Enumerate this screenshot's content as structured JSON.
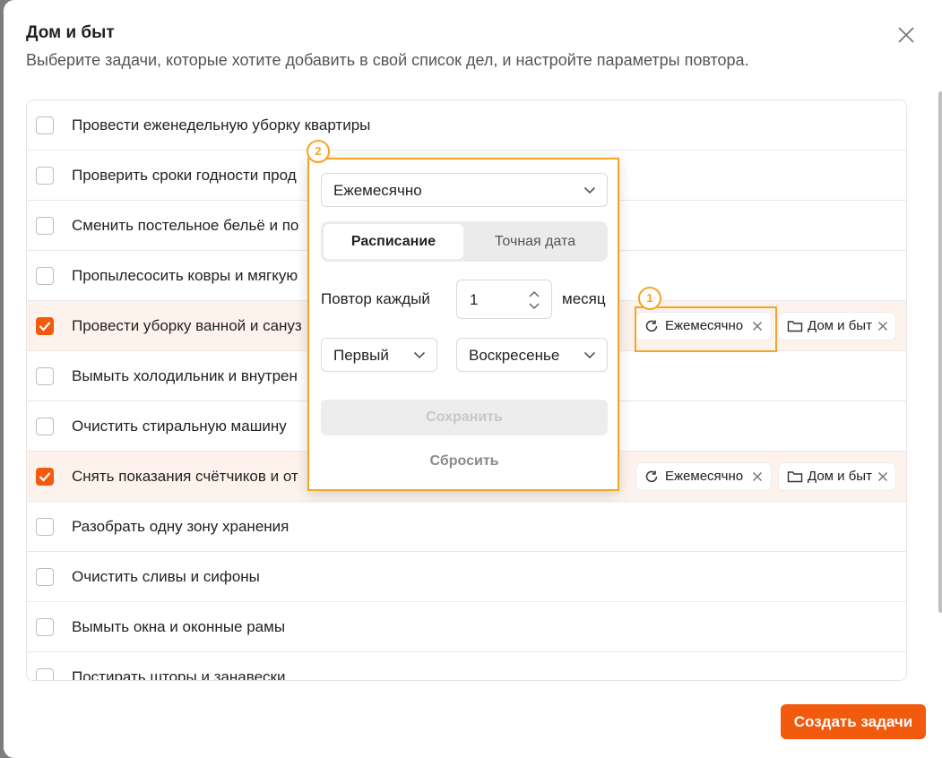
{
  "dialog": {
    "title": "Дом и быт",
    "subtitle": "Выберите задачи, которые хотите добавить в свой список дел, и настройте параметры повтора."
  },
  "tasks": [
    {
      "label": "Провести еженедельную уборку квартиры",
      "checked": false
    },
    {
      "label": "Проверить сроки годности прод",
      "checked": false
    },
    {
      "label": "Сменить постельное бельё и по",
      "checked": false
    },
    {
      "label": "Пропылесосить ковры и мягкую",
      "checked": false
    },
    {
      "label": "Провести уборку ванной и сануз",
      "checked": true,
      "repeat_tag": "Ежемесячно",
      "folder_tag": "Дом и быт"
    },
    {
      "label": "Вымыть холодильник и внутрен",
      "checked": false
    },
    {
      "label": "Очистить стиральную машину",
      "checked": false
    },
    {
      "label": "Снять показания счётчиков и от",
      "checked": true,
      "repeat_tag": "Ежемесячно",
      "folder_tag": "Дом и быт"
    },
    {
      "label": "Разобрать одну зону хранения",
      "checked": false
    },
    {
      "label": "Очистить сливы и сифоны",
      "checked": false
    },
    {
      "label": "Вымыть окна и оконные рамы",
      "checked": false
    },
    {
      "label": "Постирать шторы и занавески",
      "checked": false
    }
  ],
  "popover": {
    "frequency": "Ежемесячно",
    "tabs": {
      "active": "Расписание",
      "inactive": "Точная дата"
    },
    "repeat_label": "Повтор каждый",
    "repeat_value": "1",
    "unit": "месяц",
    "week_ordinal": "Первый",
    "weekday": "Воскресенье",
    "save_label": "Сохранить",
    "reset_label": "Сбросить"
  },
  "annotations": {
    "badge1": "1",
    "badge2": "2"
  },
  "footer": {
    "create_label": "Создать задачи"
  },
  "colors": {
    "accent": "#f25a0d",
    "highlight": "#f5a425",
    "checked_row": "#fdf3ec"
  }
}
